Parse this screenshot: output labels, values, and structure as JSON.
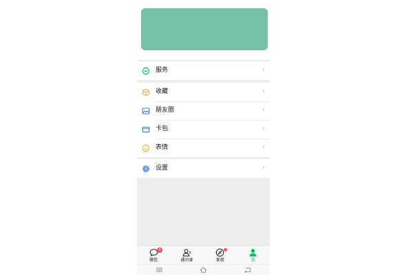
{
  "services": [
    {
      "label": "服务",
      "icon": "services-icon"
    }
  ],
  "features": [
    {
      "label": "收藏",
      "icon": "favorites-icon"
    },
    {
      "label": "朋友圈",
      "icon": "moments-icon"
    },
    {
      "label": "卡包",
      "icon": "card-wallet-icon"
    },
    {
      "label": "表情",
      "icon": "stickers-icon"
    }
  ],
  "settings": [
    {
      "label": "设置",
      "icon": "settings-icon"
    }
  ],
  "chevron": "›",
  "tabbar": {
    "tabs": [
      {
        "label": "微信",
        "icon": "chats-icon",
        "badge": "4",
        "active": false
      },
      {
        "label": "通讯录",
        "icon": "contacts-icon",
        "active": false
      },
      {
        "label": "发现",
        "icon": "discover-icon",
        "dot": true,
        "active": false
      },
      {
        "label": "我",
        "icon": "me-icon",
        "active": true
      }
    ]
  },
  "colors": {
    "profile_card": "#73c2a9",
    "accent_green": "#07c160",
    "badge_red": "#fa5151"
  }
}
